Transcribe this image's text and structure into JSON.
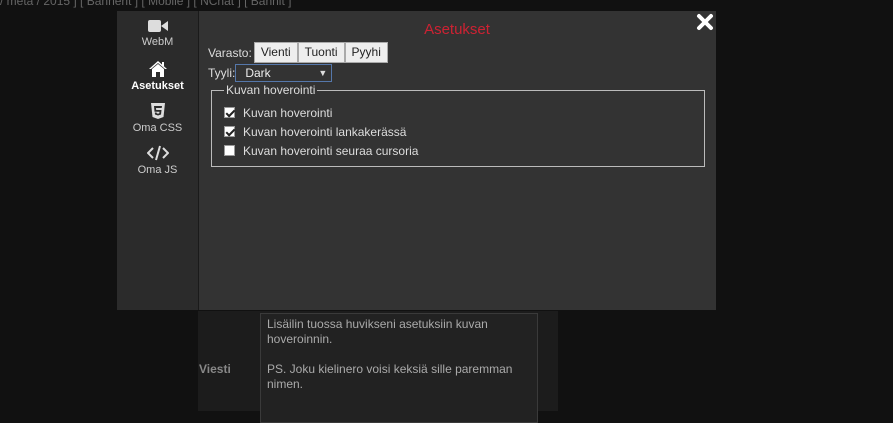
{
  "background": {
    "top_links": "/ meta / 2015 ] [ Bannerit ] [ Mobile ] [ NChat ] [ Bannit ]",
    "message_label": "Viesti",
    "message_text": "Lisäilin tuossa huvikseni asetuksiin kuvan hoveroinnin.\n\nPS. Joku kielinero voisi keksiä sille paremman nimen."
  },
  "modal": {
    "title": "Asetukset",
    "close_icon": "close-x-icon",
    "sidebar": [
      {
        "label": "WebM",
        "icon": "video-camera-icon",
        "active": false
      },
      {
        "label": "Asetukset",
        "icon": "home-icon",
        "active": true
      },
      {
        "label": "Oma CSS",
        "icon": "css3-icon",
        "active": false
      },
      {
        "label": "Oma JS",
        "icon": "code-icon",
        "active": false
      }
    ],
    "storage": {
      "label": "Varasto:",
      "export_label": "Vienti",
      "import_label": "Tuonti",
      "clear_label": "Pyyhi"
    },
    "style": {
      "label": "Tyyli:",
      "selected": "Dark"
    },
    "hover_group": {
      "legend": "Kuvan hoverointi",
      "options": [
        {
          "label": "Kuvan hoverointi",
          "checked": true
        },
        {
          "label": "Kuvan hoverointi lankakerässä",
          "checked": true
        },
        {
          "label": "Kuvan hoverointi seuraa cursoria",
          "checked": false
        }
      ]
    }
  },
  "colors": {
    "title_red": "#cc2233",
    "modal_bg": "#333333",
    "sidebar_bg": "#2b2b2b"
  }
}
